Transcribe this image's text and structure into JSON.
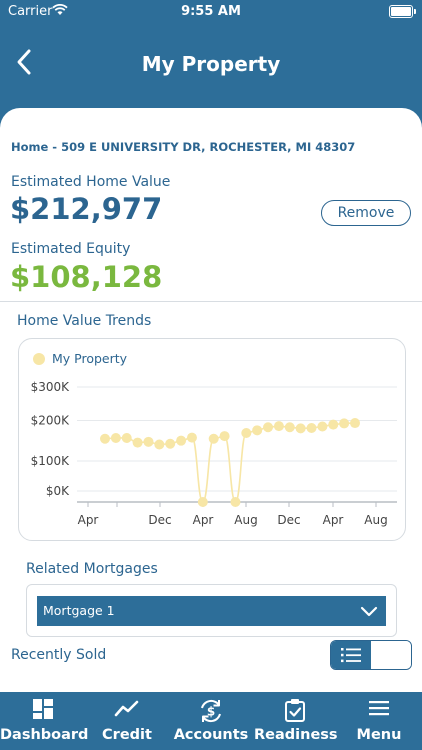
{
  "status": {
    "carrier": "Carrier",
    "time": "9:55 AM"
  },
  "header": {
    "title": "My Property"
  },
  "property": {
    "address": "Home - 509 E UNIVERSITY DR, ROCHESTER, MI 48307",
    "home_value_label": "Estimated Home Value",
    "home_value": "$212,977",
    "remove_label": "Remove",
    "equity_label": "Estimated Equity",
    "equity": "$108,128"
  },
  "trends": {
    "title": "Home Value Trends"
  },
  "chart_data": {
    "type": "line",
    "series": [
      {
        "name": "My Property",
        "color": "#f7e6a6",
        "values": [
          165000,
          167000,
          167000,
          155000,
          157000,
          150000,
          152000,
          160000,
          168000,
          0,
          165000,
          172000,
          0,
          180000,
          187000,
          195000,
          198000,
          195000,
          192000,
          193000,
          197000,
          202000,
          205000,
          206000
        ]
      }
    ],
    "x_tick_labels": [
      "Apr",
      "Dec",
      "Apr",
      "Aug",
      "Dec",
      "Apr",
      "Aug"
    ],
    "y_tick_labels": [
      "$300K",
      "$200K",
      "$100K",
      "$0K"
    ],
    "ylim": [
      0,
      300000
    ],
    "grid": true,
    "legend": "top-left"
  },
  "mortgages": {
    "title": "Related Mortgages",
    "selected": "Mortgage 1"
  },
  "recently_sold": {
    "title": "Recently Sold"
  },
  "tabs": [
    {
      "label": "Dashboard",
      "icon": "dashboard-icon"
    },
    {
      "label": "Credit",
      "icon": "credit-icon"
    },
    {
      "label": "Accounts",
      "icon": "accounts-icon"
    },
    {
      "label": "Readiness",
      "icon": "readiness-icon"
    },
    {
      "label": "Menu",
      "icon": "menu-icon"
    }
  ]
}
